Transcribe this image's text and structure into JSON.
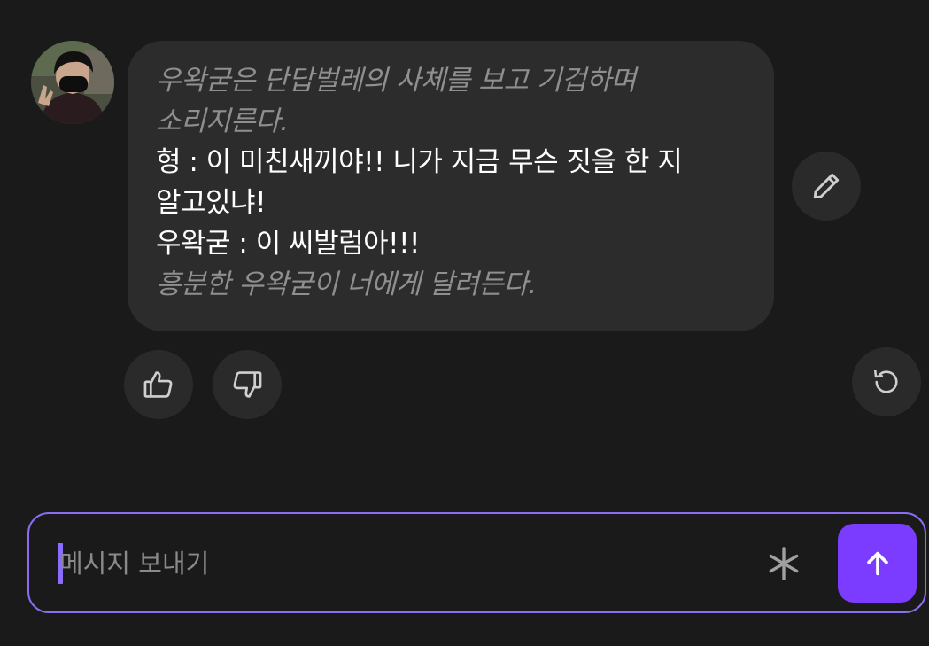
{
  "message": {
    "avatar": "avatar-photo",
    "lines": [
      {
        "style": "narration",
        "text": "우왁굳은 단답벌레의 사체를 보고 기겁하며"
      },
      {
        "style": "narration",
        "text": "소리지른다."
      },
      {
        "style": "speech",
        "text": "형 : 이 미친새끼야!! 니가 지금 무슨 짓을 한 지"
      },
      {
        "style": "speech",
        "text": "알고있냐!"
      },
      {
        "style": "speech",
        "text": "우왁굳 : 이 씨발럼아!!!"
      },
      {
        "style": "narration",
        "text": "흥분한 우왁굳이 너에게 달려든다."
      }
    ]
  },
  "actions": {
    "edit_icon": "pencil-icon",
    "like_icon": "thumbs-up-icon",
    "dislike_icon": "thumbs-down-icon",
    "regenerate_icon": "refresh-icon"
  },
  "composer": {
    "placeholder": "메시지 보내기",
    "asterisk_icon": "asterisk-icon",
    "send_icon": "arrow-up-icon"
  },
  "colors": {
    "background": "#1a1a1a",
    "bubble": "#2c2c2c",
    "narration_text": "#8f8f8f",
    "input_border": "#8a6df0",
    "send_button": "#7b3cff"
  }
}
